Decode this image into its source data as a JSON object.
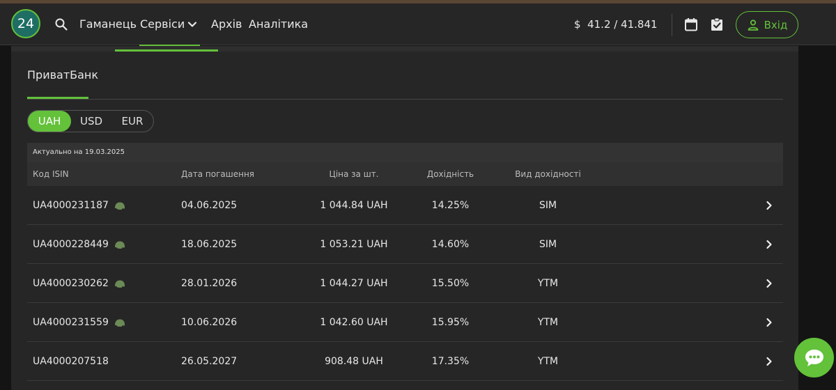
{
  "header": {
    "logo_text": "24",
    "nav": {
      "wallet": "Гаманець",
      "services": "Сервіси",
      "archive": "Архів",
      "analytics": "Аналітика"
    },
    "rate_symbol": "$",
    "rate_value": "41.2 / 41.841",
    "login_label": "Вхід"
  },
  "bank_tab": "ПриватБанк",
  "currencies": [
    {
      "label": "UAH",
      "active": true
    },
    {
      "label": "USD",
      "active": false
    },
    {
      "label": "EUR",
      "active": false
    }
  ],
  "table": {
    "caption": "Актуально на 19.03.2025",
    "columns": {
      "isin": "Код ISIN",
      "maturity": "Дата погашення",
      "price": "Ціна за шт.",
      "yield": "Дохідність",
      "yield_type": "Вид дохідності"
    },
    "rows": [
      {
        "isin": "UA4000231187",
        "military": true,
        "maturity": "04.06.2025",
        "price": "1 044.84 UAH",
        "yield": "14.25%",
        "yield_type": "SIM"
      },
      {
        "isin": "UA4000228449",
        "military": true,
        "maturity": "18.06.2025",
        "price": "1 053.21 UAH",
        "yield": "14.60%",
        "yield_type": "SIM"
      },
      {
        "isin": "UA4000230262",
        "military": true,
        "maturity": "28.01.2026",
        "price": "1 044.27 UAH",
        "yield": "15.50%",
        "yield_type": "YTM"
      },
      {
        "isin": "UA4000231559",
        "military": true,
        "maturity": "10.06.2026",
        "price": "1 042.60 UAH",
        "yield": "15.95%",
        "yield_type": "YTM"
      },
      {
        "isin": "UA4000207518",
        "military": false,
        "maturity": "26.05.2027",
        "price": "908.48 UAH",
        "yield": "17.35%",
        "yield_type": "YTM"
      }
    ]
  },
  "colors": {
    "accent": "#63c13a",
    "header_bg": "#262626",
    "page_bg": "#141414",
    "helmet": "#6b8a55"
  },
  "icons": [
    "search-icon",
    "chevron-down-icon",
    "calendar-icon",
    "clipboard-check-icon",
    "user-icon",
    "helmet-icon",
    "chevron-right-icon",
    "chat-icon"
  ]
}
